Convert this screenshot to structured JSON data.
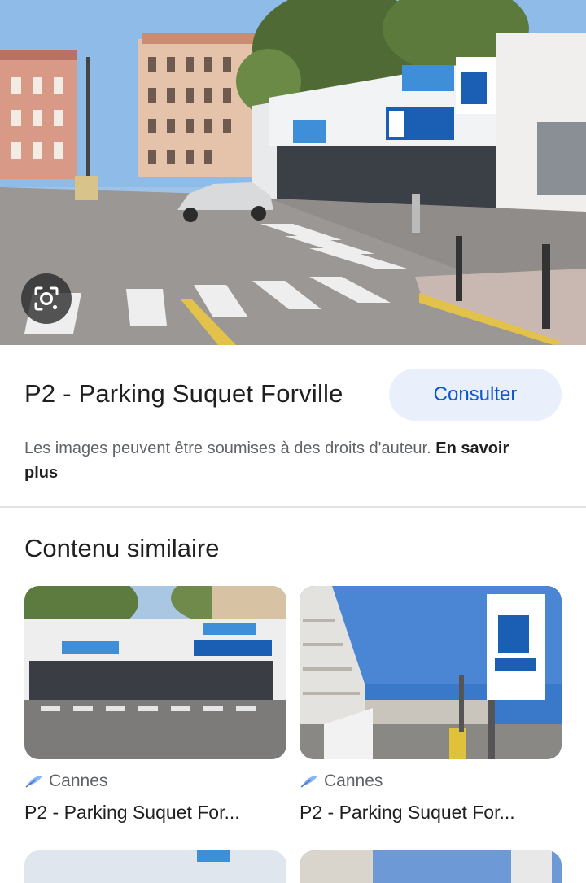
{
  "hero": {
    "lens_icon": "lens-search-icon"
  },
  "result": {
    "title": "P2 - Parking Suquet Forville",
    "consult_label": "Consulter",
    "copyright_text": "Les images peuvent être soumises à des droits d'auteur.",
    "learn_more": "En savoir plus"
  },
  "similar": {
    "heading": "Contenu similaire",
    "cards": [
      {
        "source": "Cannes",
        "source_icon": "feather-icon",
        "title": "P2 - Parking Suquet For..."
      },
      {
        "source": "Cannes",
        "source_icon": "feather-icon",
        "title": "P2 - Parking Suquet For..."
      }
    ]
  },
  "colors": {
    "accent": "#0b57d0",
    "button_bg": "#e9f0fb",
    "secondary_text": "#5f6368",
    "parking_blue": "#1a5fb4"
  }
}
